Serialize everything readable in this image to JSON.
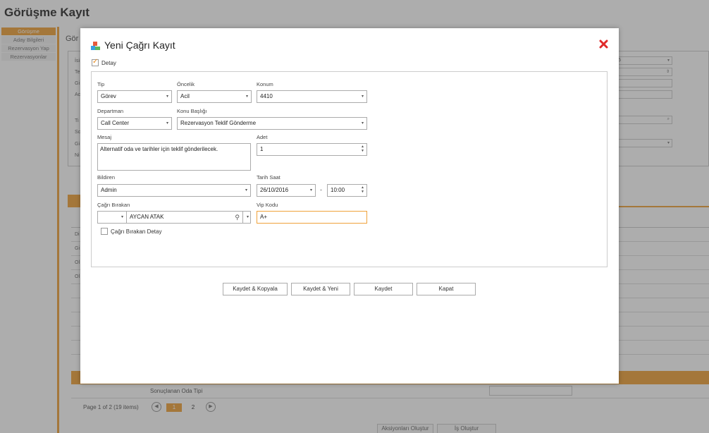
{
  "background": {
    "title": "Görüşme Kayıt",
    "sidebar": [
      "Görüşme",
      "Aday Bilgileri",
      "Rezervasyon Yap",
      "Rezervasyonlar"
    ],
    "panel_title": "Gör",
    "labels_top": [
      "İsi",
      "Te",
      "Gi",
      "Ac"
    ],
    "labels_mid": [
      "Ti",
      "Sc",
      "Gi",
      "Ni"
    ],
    "grid_rows": [
      "Di",
      "Gi",
      "Ol",
      "Ol"
    ],
    "sonuc_label": "Sonuçlanan Oda Tipi",
    "pager_text": "Page 1 of 2 (19 items)",
    "pages": [
      "1",
      "2"
    ],
    "bottom_buttons": [
      "Aksiyonları Oluştur",
      "İş Oluştur"
    ],
    "field_value_5": "5"
  },
  "modal": {
    "title": "Yeni Çağrı Kayıt",
    "detay_label": "Detay",
    "detay_checked": true,
    "labels": {
      "tip": "Tip",
      "oncelik": "Öncelik",
      "konum": "Konum",
      "departman": "Departman",
      "konu": "Konu Başlığı",
      "mesaj": "Mesaj",
      "adet": "Adet",
      "bildiren": "Bildiren",
      "tarih": "Tarih Saat",
      "cagri_birakan": "Çağrı Bırakan",
      "vip": "Vip Kodu",
      "cagri_detay": "Çağrı Bırakan Detay"
    },
    "values": {
      "tip": "Görev",
      "oncelik": "Acil",
      "konum": "4410",
      "departman": "Call Center",
      "konu": "Rezervasyon Teklif Gönderme",
      "mesaj": "Alternatif oda ve tarihler için teklif gönderilecek.",
      "adet": "1",
      "bildiren": "Admin",
      "tarih": "26/10/2016",
      "saat": "10:00",
      "cagri_birakan": "AYCAN ATAK",
      "vip": "A+"
    },
    "buttons": [
      "Kaydet & Kopyala",
      "Kaydet & Yeni",
      "Kaydet",
      "Kapat"
    ]
  },
  "colors": {
    "accent": "#f0a23a",
    "close": "#e02a2a"
  }
}
